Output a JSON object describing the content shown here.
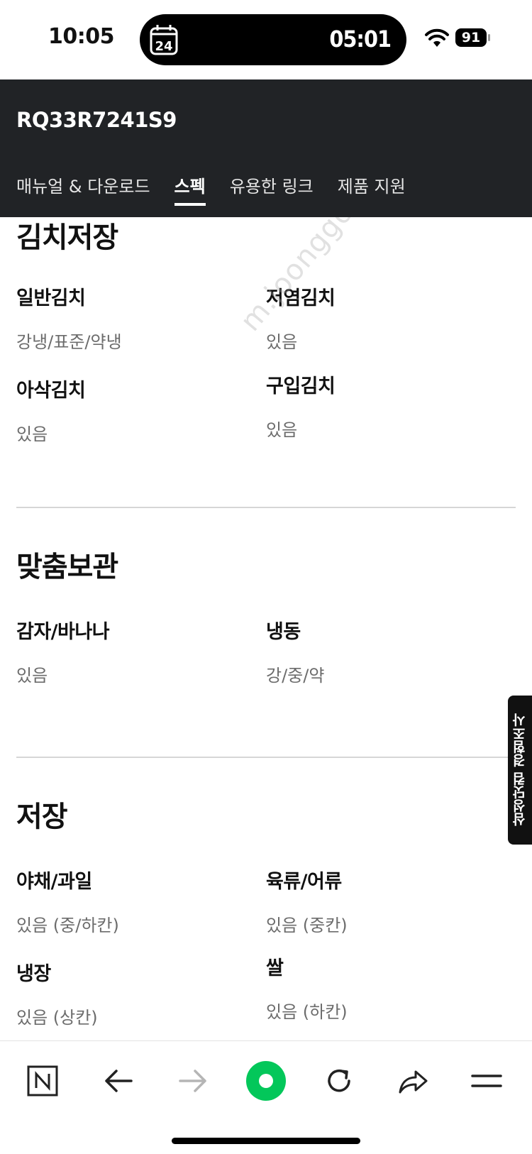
{
  "status_bar": {
    "time": "10:05",
    "calendar_day": "24",
    "timer": "05:01",
    "battery": "91"
  },
  "header": {
    "model": "RQ33R7241S9",
    "tabs": [
      {
        "label": "매뉴얼 & 다운로드",
        "active": false
      },
      {
        "label": "스펙",
        "active": true
      },
      {
        "label": "유용한 링크",
        "active": false
      },
      {
        "label": "제품 지원",
        "active": false
      }
    ]
  },
  "watermark": "m.joonggonara",
  "sections": [
    {
      "title": "김치저장",
      "specs": [
        {
          "label": "일반김치",
          "value": "강냉/표준/약냉"
        },
        {
          "label": "저염김치",
          "value": "있음"
        },
        {
          "label": "아삭김치",
          "value": "있음"
        },
        {
          "label": "구입김치",
          "value": "있음"
        }
      ]
    },
    {
      "title": "맞춤보관",
      "specs": [
        {
          "label": "감자/바나나",
          "value": "있음"
        },
        {
          "label": "냉동",
          "value": "강/중/약"
        }
      ]
    },
    {
      "title": "저장",
      "specs": [
        {
          "label": "야채/과일",
          "value": "있음 (중/하칸)"
        },
        {
          "label": "육류/어류",
          "value": "있음 (중칸)"
        },
        {
          "label": "냉장",
          "value": "있음 (상칸)"
        },
        {
          "label": "쌀",
          "value": "있음 (하칸)"
        }
      ]
    }
  ],
  "survey_tab": "삼성닷컴 경험조사",
  "toolbar": {
    "icons": [
      "naver-n-icon",
      "back-arrow-icon",
      "forward-arrow-icon",
      "green-dot-icon",
      "reload-icon",
      "share-icon",
      "menu-icon"
    ],
    "accent_green": "#03c75a"
  }
}
